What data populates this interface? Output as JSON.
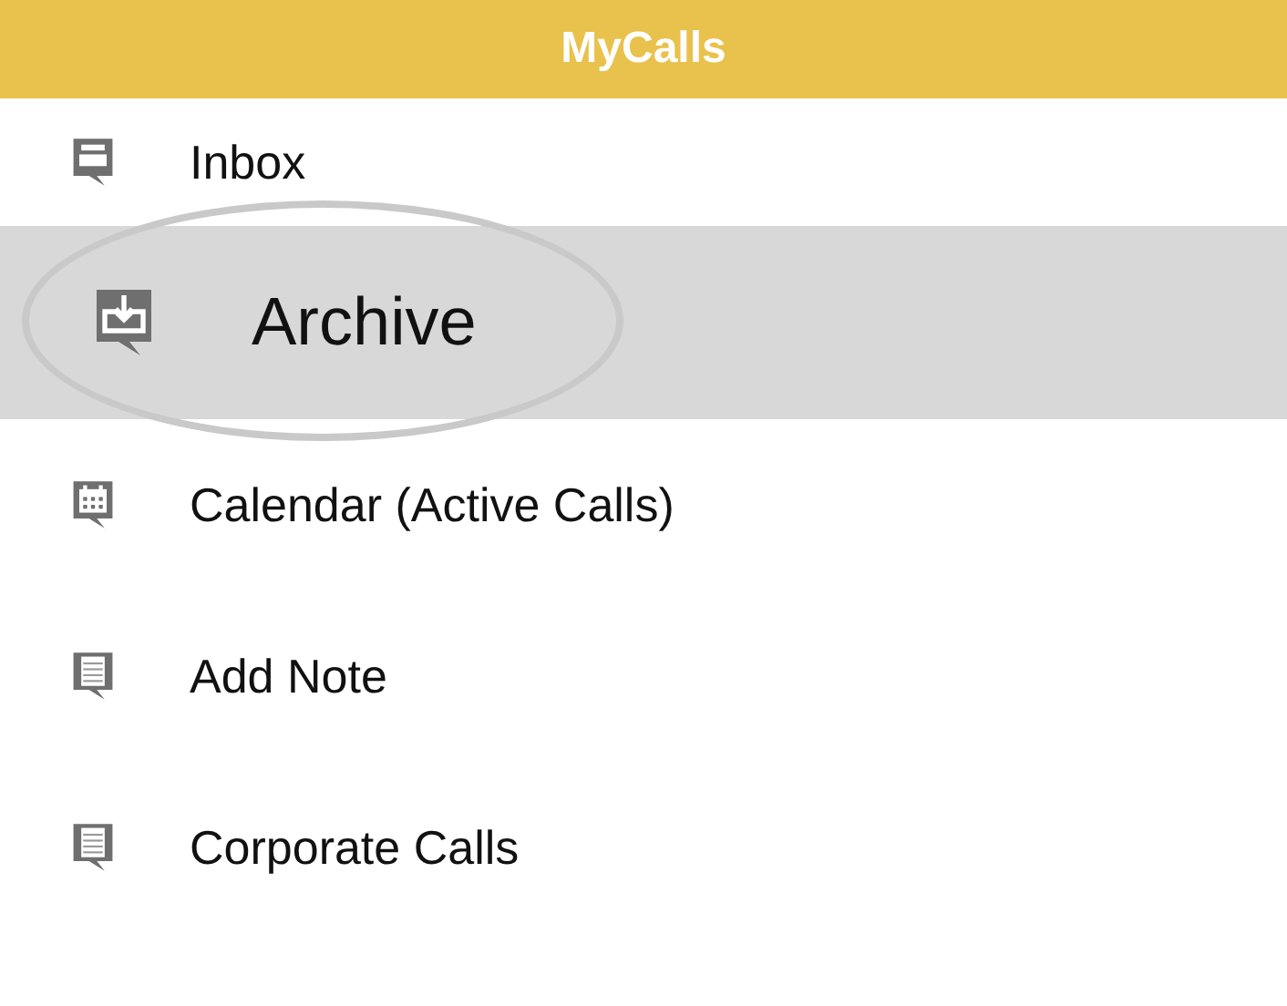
{
  "header": {
    "title": "MyCalls"
  },
  "menu": [
    {
      "label": "Inbox",
      "kind": "inbox",
      "selected": false
    },
    {
      "label": "Archive",
      "kind": "archive",
      "selected": true
    },
    {
      "label": "Calendar (Active Calls)",
      "kind": "calendar",
      "selected": false
    },
    {
      "label": "Add Note",
      "kind": "note",
      "selected": false
    },
    {
      "label": "Corporate Calls",
      "kind": "note",
      "selected": false
    }
  ]
}
